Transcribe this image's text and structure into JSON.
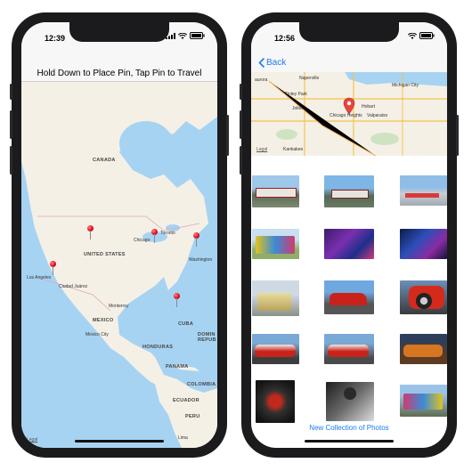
{
  "left_screen": {
    "status_time": "12:39",
    "nav_title": "Hold Down to Place Pin, Tap Pin to Travel",
    "map_labels": {
      "canada": "CANADA",
      "united_states": "UNITED STATES",
      "mexico": "MEXICO",
      "cuba": "CUBA",
      "honduras": "HONDURAS",
      "panama": "PANAMA",
      "colombia": "COLOMBIA",
      "ecuador": "ECUADOR",
      "peru": "PERU",
      "dominican": "DOMIN",
      "republic": "REPUB"
    },
    "city_labels": {
      "chicago": "Chicago",
      "toronto": "Toronto",
      "washington": "Washington",
      "los_angeles": "Los Angeles",
      "ciudad_juarez": "Ciudad Juárez",
      "monterrey": "Monterrey",
      "mexico_city": "Mexico City",
      "lima": "Lima"
    },
    "legal": "Legal",
    "pins": [
      "pin-montana",
      "pin-chicago",
      "pin-new-york",
      "pin-los-angeles",
      "pin-florida"
    ]
  },
  "right_screen": {
    "status_time": "12:56",
    "back_label": "Back",
    "map_labels": {
      "naperville": "Naperville",
      "tinley_park": "Tinley Park",
      "joliet": "Joliet",
      "chicago_heights": "Chicago Heights",
      "hobart": "Hobart",
      "valparaiso": "Valparaiso",
      "michigan_city": "Michigan City",
      "kankakee": "Kankakee",
      "aurora": "aurora"
    },
    "legal": "Legal",
    "photos": [
      "train-photo",
      "train-photo-2",
      "boat-photo",
      "bus-photo",
      "bus-interior-photo",
      "party-bus-photo",
      "food-truck-photo",
      "red-car-photo",
      "red-wheel-photo",
      "muscle-car-photo",
      "muscle-car-photo-2",
      "orange-car-photo",
      "engine-photo",
      "guitarist-photo",
      "bus-photo-2"
    ],
    "new_collection_label": "New Collection of Photos"
  },
  "colors": {
    "accent": "#1a7bf0",
    "water": "#a7d3f2",
    "land": "#f5f0e6",
    "pin": "#e0001b"
  }
}
